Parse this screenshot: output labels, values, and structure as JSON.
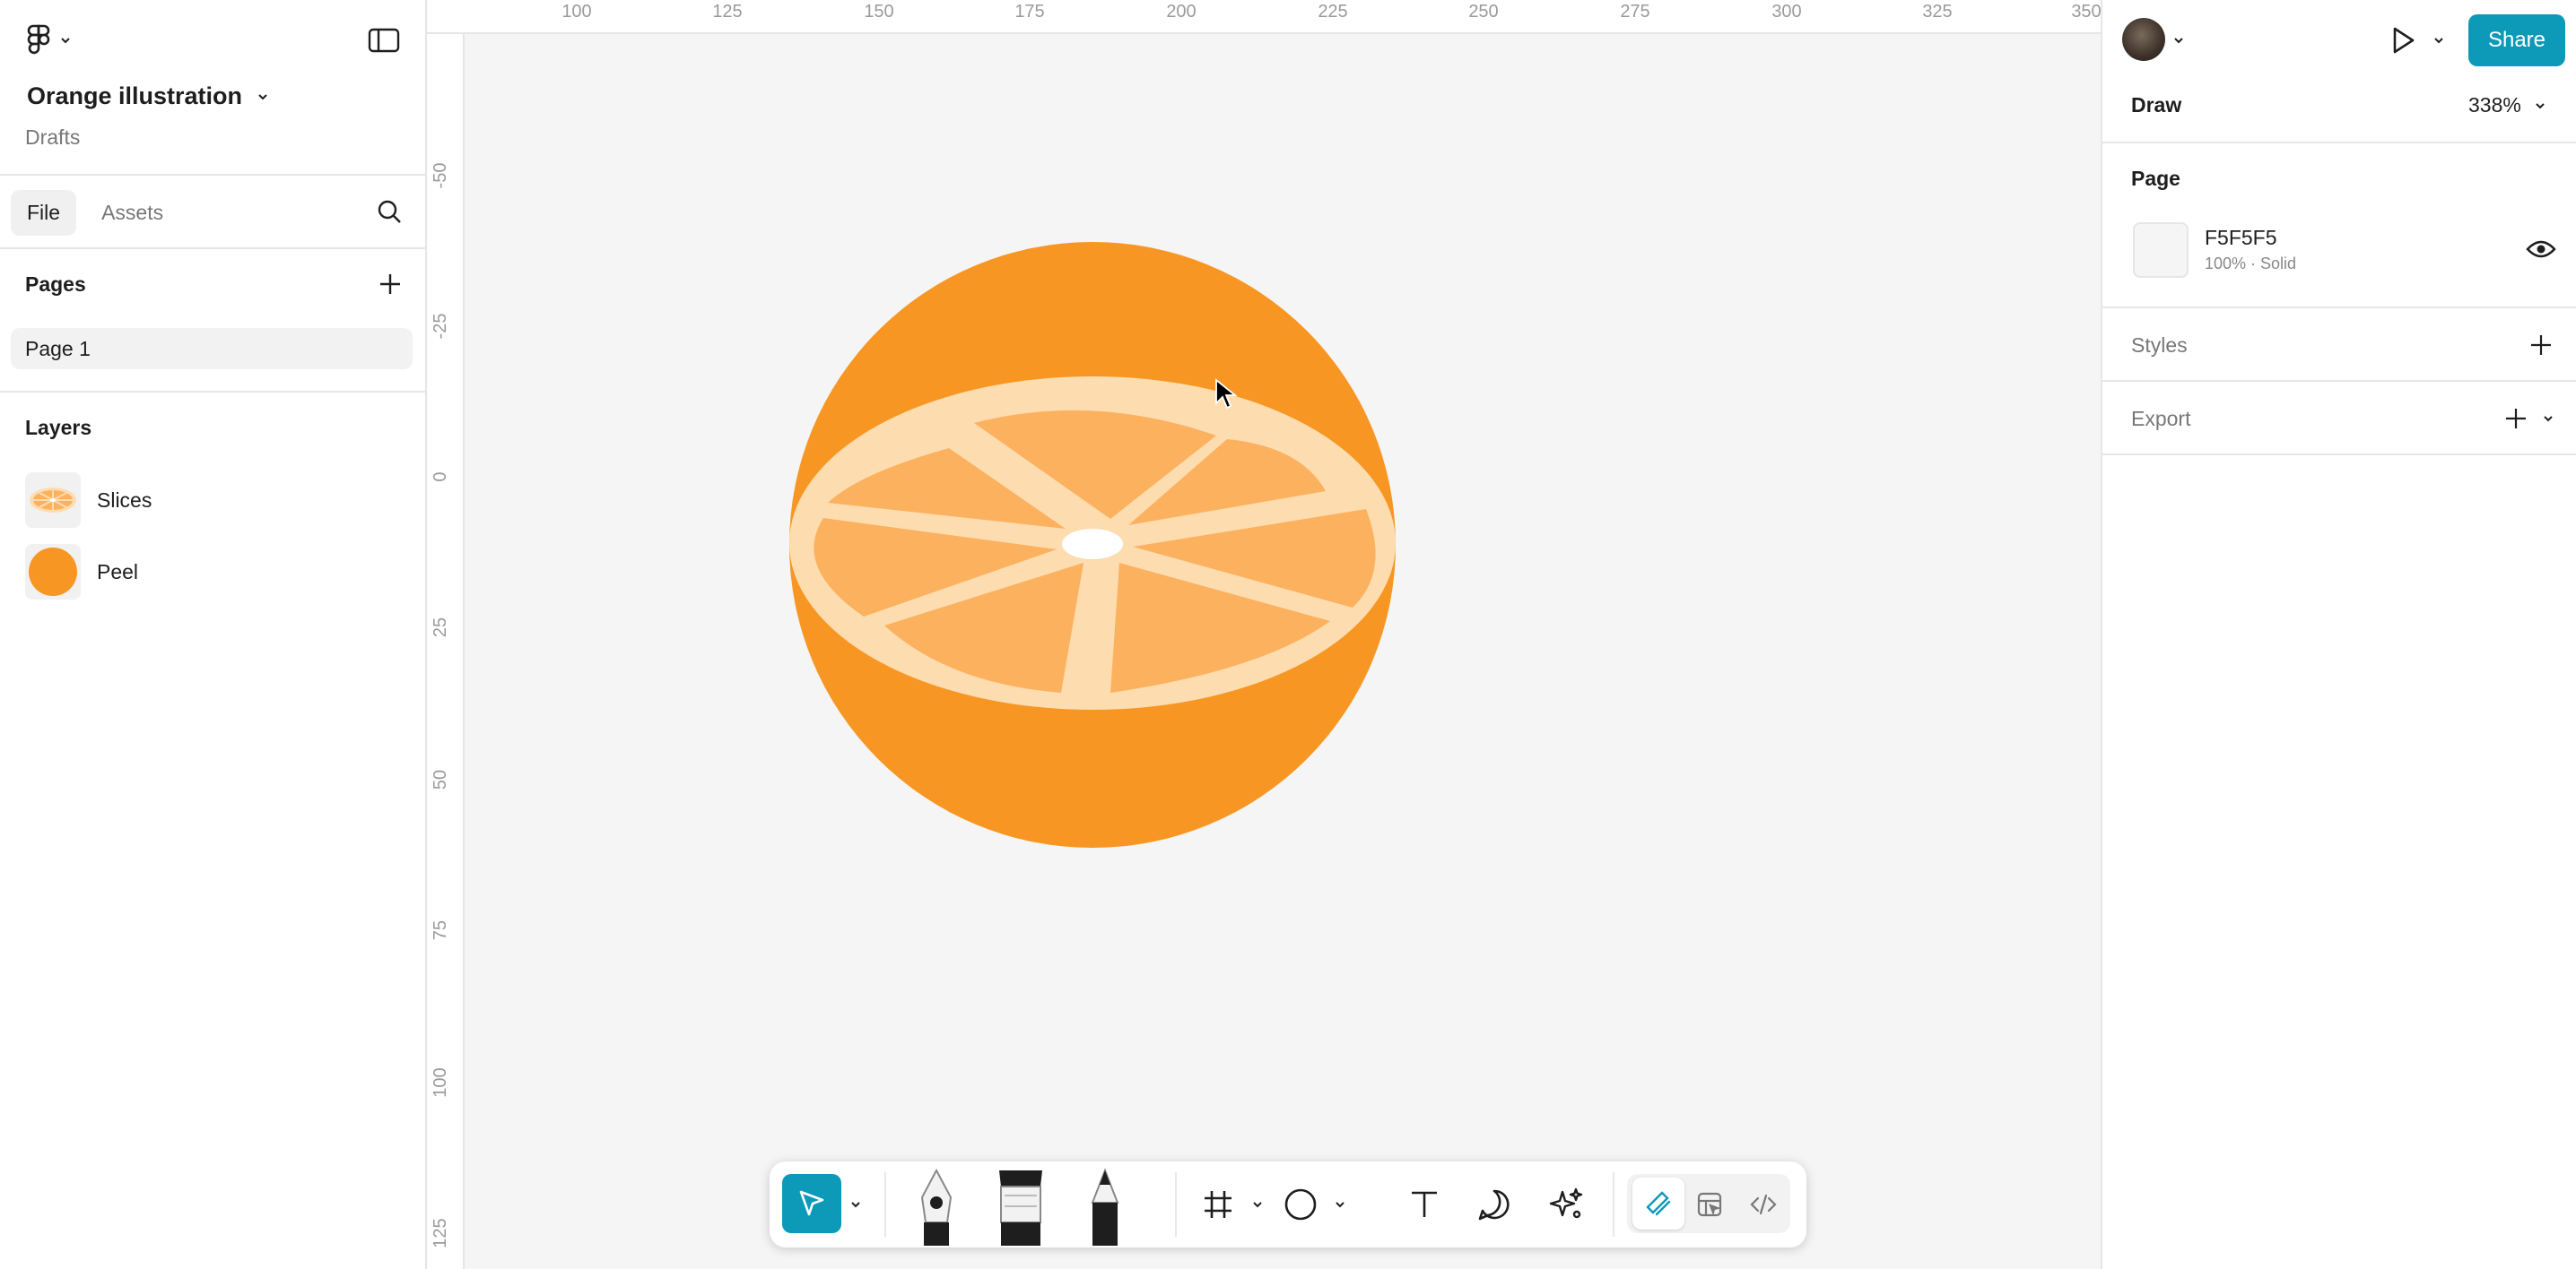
{
  "left_panel": {
    "file_title": "Orange illustration",
    "file_location": "Drafts",
    "tabs": [
      {
        "label": "File"
      },
      {
        "label": "Assets"
      }
    ],
    "pages_title": "Pages",
    "pages": [
      {
        "label": "Page 1"
      }
    ],
    "layers_title": "Layers",
    "layers": [
      {
        "label": "Slices"
      },
      {
        "label": "Peel"
      }
    ]
  },
  "rulers": {
    "top": [
      "100",
      "125",
      "150",
      "175",
      "200",
      "225",
      "250",
      "275",
      "300",
      "325",
      "350"
    ],
    "left": [
      "-50",
      "-25",
      "0",
      "25",
      "50",
      "75",
      "100",
      "125"
    ]
  },
  "right_panel": {
    "share_label": "Share",
    "mode": "Draw",
    "zoom": "338%",
    "page_section": "Page",
    "page_fill": {
      "hex": "F5F5F5",
      "detail": "100% · Solid"
    },
    "styles_label": "Styles",
    "export_label": "Export"
  },
  "colors": {
    "accent": "#0d99b8",
    "peel": "#f79622",
    "pith": "#fddcb0",
    "segment": "#fcb15f",
    "page_background": "#f5f5f5"
  },
  "toolbar": {
    "tools": [
      "move-icon",
      "pen-icon",
      "brush-icon",
      "pencil-icon",
      "frame-icon",
      "ellipse-icon",
      "text-icon",
      "comment-icon",
      "ai-sparkle-icon",
      "draw-mode-icon",
      "design-mode-icon",
      "dev-mode-icon"
    ]
  }
}
